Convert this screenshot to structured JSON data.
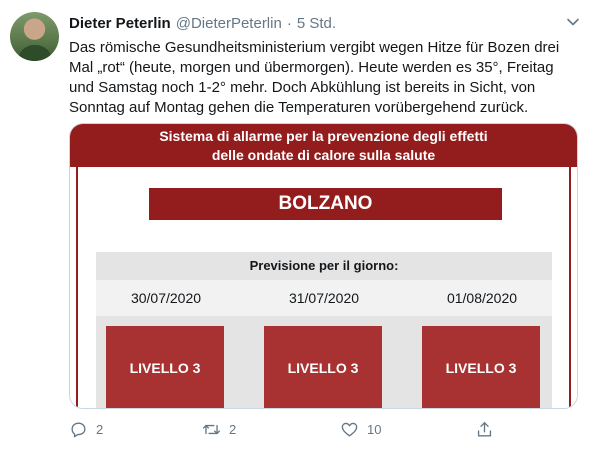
{
  "tweet": {
    "author_name": "Dieter Peterlin",
    "author_handle": "@DieterPeterlin",
    "separator": "·",
    "time": "5 Std.",
    "text_lines": [
      "Das römische Gesundheitsministerium vergibt wegen Hitze für Bozen drei",
      "Mal „rot“ (heute, morgen und übermorgen). Heute werden es 35°, Freitag",
      "und Samstag noch 1-2° mehr. Doch Abkühlung ist bereits in Sicht, von",
      "Sonntag auf Montag gehen die Temperaturen vorübergehend zurück."
    ]
  },
  "media": {
    "banner_lines": [
      "Sistema di allarme per la prevenzione degli effetti",
      "delle ondate di calore sulla salute"
    ],
    "city": "BOLZANO",
    "forecast_label": "Previsione per il giorno:",
    "days": [
      {
        "date": "30/07/2020",
        "level": "LIVELLO 3"
      },
      {
        "date": "31/07/2020",
        "level": "LIVELLO 3"
      },
      {
        "date": "01/08/2020",
        "level": "LIVELLO 3"
      }
    ]
  },
  "actions": {
    "reply_count": "2",
    "retweet_count": "2",
    "like_count": "10",
    "share_count": ""
  },
  "icons": {
    "reply": "reply-icon",
    "retweet": "retweet-icon",
    "like": "heart-icon",
    "share": "share-icon",
    "more": "chevron-down-icon"
  },
  "colors": {
    "banner": "#931d1d",
    "level_box": "#a83232",
    "muted_text": "#657786"
  }
}
